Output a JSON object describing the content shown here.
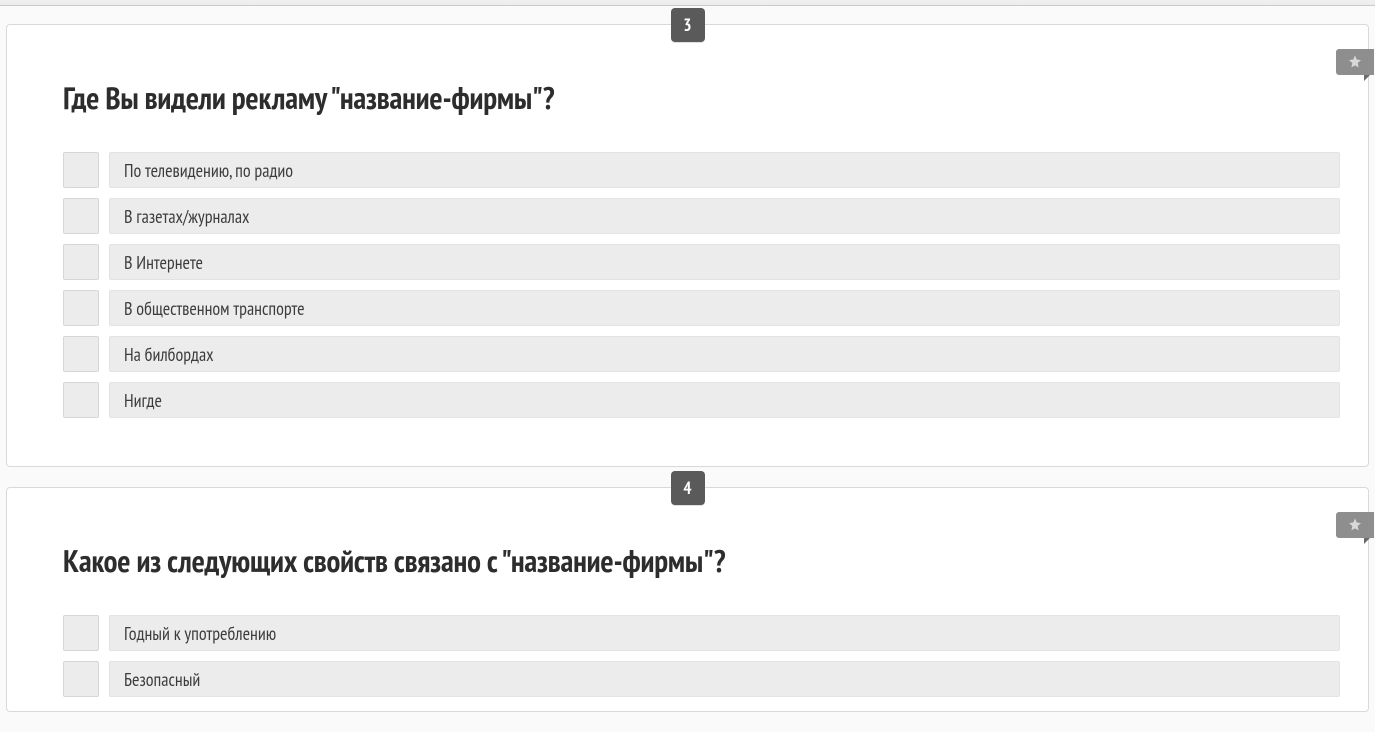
{
  "questions": [
    {
      "number": "3",
      "title": "Где Вы видели рекламу \"название-фирмы\"?",
      "options": [
        "По телевидению, по радио",
        "В газетах/журналах",
        "В Интернете",
        "В общественном транспорте",
        "На билбордах",
        "Нигде"
      ]
    },
    {
      "number": "4",
      "title": "Какое из следующих свойств связано с \"название-фирмы\"?",
      "options": [
        "Годный к употреблению",
        "Безопасный"
      ]
    }
  ]
}
